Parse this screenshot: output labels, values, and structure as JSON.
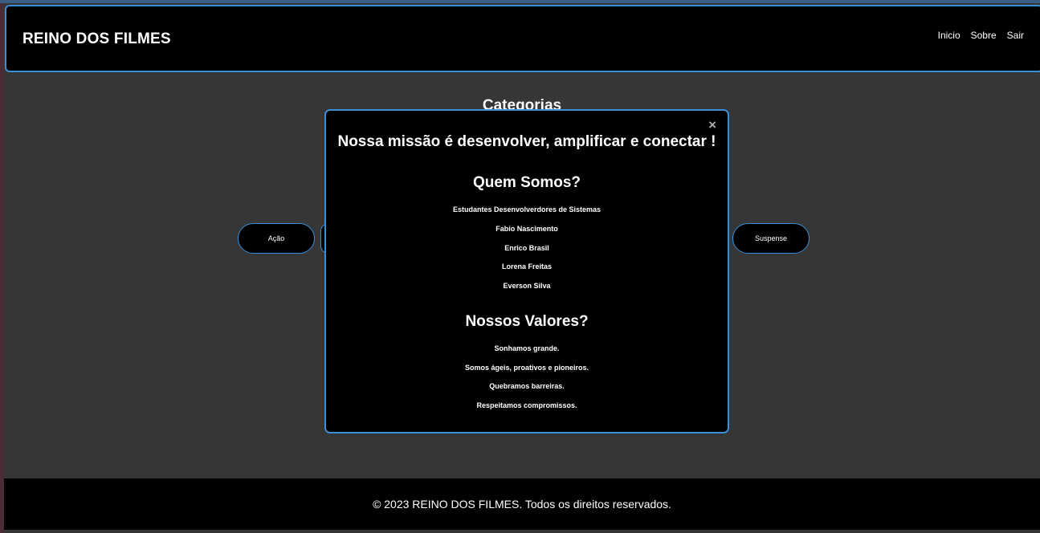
{
  "header": {
    "brand": "REINO DOS FILMES",
    "nav": [
      "Inicio",
      "Sobre",
      "Sair"
    ]
  },
  "main": {
    "title": "Categorias",
    "categories": [
      "Ação",
      "Suspense"
    ]
  },
  "modal": {
    "close": "×",
    "mission": "Nossa missão é desenvolver, amplificar e conectar !",
    "about_title": "Quem Somos?",
    "about_lines": [
      "Estudantes Desenvolverdores de Sistemas",
      "Fabio Nascimento",
      "Enrico Brasil",
      "Lorena Freitas",
      "Everson Silva"
    ],
    "values_title": "Nossos Valores?",
    "values_lines": [
      "Sonhamos grande.",
      "Somos ágeis, proativos e pioneiros.",
      "Quebramos barreiras.",
      "Respeitamos compromissos."
    ]
  },
  "footer": {
    "text": "© 2023 REINO DOS FILMES. Todos os direitos reservados."
  },
  "colors": {
    "accent": "#3a8fd9",
    "background": "#363636",
    "panel": "#000000"
  }
}
